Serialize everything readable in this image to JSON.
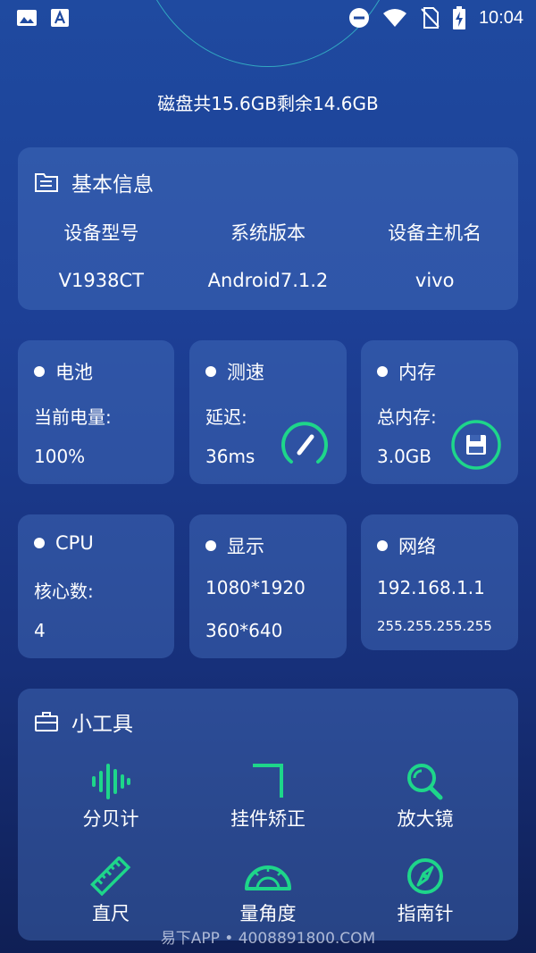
{
  "status_bar": {
    "time": "10:04",
    "icons": [
      "image-icon",
      "font-icon",
      "do-not-disturb-icon",
      "wifi-icon",
      "no-sim-icon",
      "battery-charging-icon"
    ]
  },
  "storage": {
    "text": "磁盘共15.6GB剩余14.6GB"
  },
  "basic_info": {
    "title": "基本信息",
    "icon": "folder-icon",
    "headers": [
      "设备型号",
      "系统版本",
      "设备主机名"
    ],
    "values": [
      "V1938CT",
      "Android7.1.2",
      "vivo"
    ]
  },
  "tiles": {
    "battery": {
      "title": "电池",
      "label": "当前电量:",
      "value": "100%"
    },
    "speed": {
      "title": "测速",
      "label": "延迟:",
      "value": "36ms",
      "icon": "speedometer-icon"
    },
    "memory": {
      "title": "内存",
      "label": "总内存:",
      "value": "3.0GB",
      "icon": "save-icon"
    },
    "cpu": {
      "title": "CPU",
      "label": "核心数:",
      "value": "4"
    },
    "display": {
      "title": "显示",
      "line1": "1080*1920",
      "line2": "360*640"
    },
    "network": {
      "title": "网络",
      "line1": "192.168.1.1",
      "line2": "255.255.255.255"
    }
  },
  "tools": {
    "title": "小工具",
    "icon": "briefcase-icon",
    "items": [
      {
        "label": "分贝计",
        "icon": "sound-wave-icon"
      },
      {
        "label": "挂件矫正",
        "icon": "corner-bracket-icon"
      },
      {
        "label": "放大镜",
        "icon": "magnifier-icon"
      },
      {
        "label": "直尺",
        "icon": "ruler-icon"
      },
      {
        "label": "量角度",
        "icon": "protractor-icon"
      },
      {
        "label": "指南针",
        "icon": "compass-icon"
      }
    ]
  },
  "watermark": {
    "text": "易下APP • 4008891800.COM"
  },
  "colors": {
    "accent": "#1ed68a",
    "background": "#1d3f95",
    "card": "#3d63b3"
  }
}
